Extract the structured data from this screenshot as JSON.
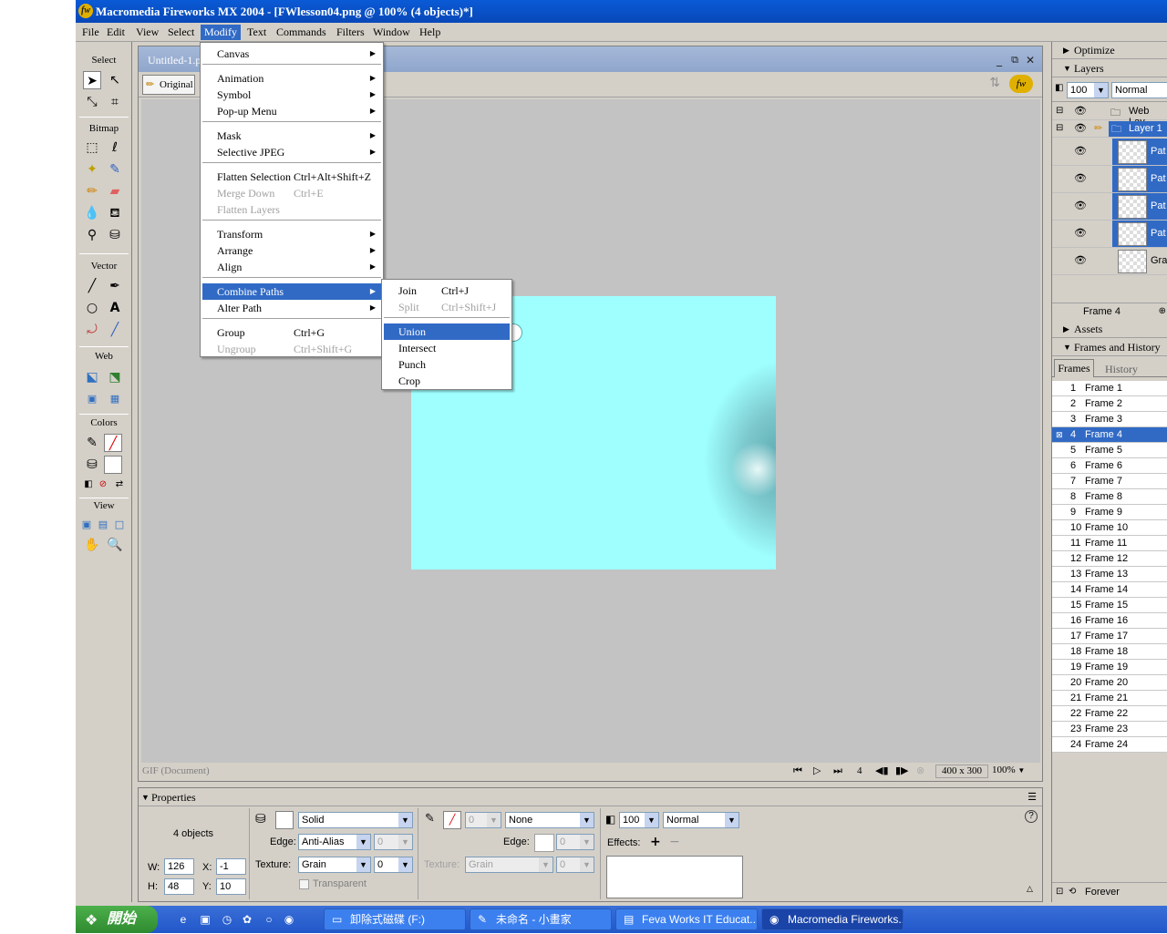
{
  "app": {
    "title": "Macromedia Fireworks MX 2004 - [FWlesson04.png @ 100% (4 objects)*]"
  },
  "menubar": [
    "File",
    "Edit",
    "View",
    "Select",
    "Modify",
    "Text",
    "Commands",
    "Filters",
    "Window",
    "Help"
  ],
  "toolbox": {
    "select": "Select",
    "bitmap": "Bitmap",
    "vector": "Vector",
    "web": "Web",
    "colors": "Colors",
    "view": "View"
  },
  "document": {
    "tab": "Untitled-1.p",
    "original": "Original",
    "status_left": "GIF (Document)",
    "frame_num": "4",
    "size": "400 x 300",
    "zoom": "100%"
  },
  "modify_menu": {
    "items": [
      {
        "label": "Canvas",
        "sub": true
      },
      {
        "label": "Animation",
        "sub": true
      },
      {
        "label": "Symbol",
        "sub": true
      },
      {
        "label": "Pop-up Menu",
        "sub": true
      },
      {
        "label": "Mask",
        "sub": true
      },
      {
        "label": "Selective JPEG",
        "sub": true
      },
      {
        "label": "Flatten Selection",
        "shortcut": "Ctrl+Alt+Shift+Z"
      },
      {
        "label": "Merge Down",
        "shortcut": "Ctrl+E",
        "disabled": true
      },
      {
        "label": "Flatten Layers",
        "disabled": true
      },
      {
        "label": "Transform",
        "sub": true
      },
      {
        "label": "Arrange",
        "sub": true
      },
      {
        "label": "Align",
        "sub": true
      },
      {
        "label": "Combine Paths",
        "sub": true,
        "highlighted": true
      },
      {
        "label": "Alter Path",
        "sub": true
      },
      {
        "label": "Group",
        "shortcut": "Ctrl+G"
      },
      {
        "label": "Ungroup",
        "shortcut": "Ctrl+Shift+G",
        "disabled": true
      }
    ]
  },
  "combine_menu": {
    "items": [
      {
        "label": "Join",
        "shortcut": "Ctrl+J"
      },
      {
        "label": "Split",
        "shortcut": "Ctrl+Shift+J",
        "disabled": true
      },
      {
        "label": "Union",
        "highlighted": true
      },
      {
        "label": "Intersect"
      },
      {
        "label": "Punch"
      },
      {
        "label": "Crop"
      }
    ]
  },
  "properties": {
    "title": "Properties",
    "objects": "4 objects",
    "fill_type": "Solid",
    "edge_label": "Edge:",
    "edge": "Anti-Alias",
    "edge_val": "0",
    "texture_label": "Texture:",
    "texture": "Grain",
    "texture_val": "0",
    "transparent": "Transparent",
    "stroke_size": "0",
    "stroke_type": "None",
    "stroke_edge_label": "Edge:",
    "stroke_edge_val": "0",
    "stroke_texture_label": "Texture:",
    "stroke_texture": "Grain",
    "stroke_texture_val": "0",
    "opacity": "100",
    "blend": "Normal",
    "effects": "Effects:",
    "w_label": "W:",
    "w": "126",
    "h_label": "H:",
    "h": "48",
    "x_label": "X:",
    "x": "-1",
    "y_label": "Y:",
    "y": "10"
  },
  "panels": {
    "optimize": "Optimize",
    "layers": "Layers",
    "layer_opacity": "100",
    "layer_blend": "Normal",
    "web_layer": "Web Lay",
    "layer1": "Layer 1",
    "objects": [
      "Pat",
      "Pat",
      "Pat",
      "Pat",
      "Gra"
    ],
    "frame_label": "Frame 4",
    "assets": "Assets",
    "frames_history": "Frames and History",
    "tab_frames": "Frames",
    "tab_history": "History",
    "frames": [
      {
        "n": "1",
        "name": "Frame 1"
      },
      {
        "n": "2",
        "name": "Frame 2"
      },
      {
        "n": "3",
        "name": "Frame 3"
      },
      {
        "n": "4",
        "name": "Frame 4",
        "selected": true
      },
      {
        "n": "5",
        "name": "Frame 5"
      },
      {
        "n": "6",
        "name": "Frame 6"
      },
      {
        "n": "7",
        "name": "Frame 7"
      },
      {
        "n": "8",
        "name": "Frame 8"
      },
      {
        "n": "9",
        "name": "Frame 9"
      },
      {
        "n": "10",
        "name": "Frame 10"
      },
      {
        "n": "11",
        "name": "Frame 11"
      },
      {
        "n": "12",
        "name": "Frame 12"
      },
      {
        "n": "13",
        "name": "Frame 13"
      },
      {
        "n": "14",
        "name": "Frame 14"
      },
      {
        "n": "15",
        "name": "Frame 15"
      },
      {
        "n": "16",
        "name": "Frame 16"
      },
      {
        "n": "17",
        "name": "Frame 17"
      },
      {
        "n": "18",
        "name": "Frame 18"
      },
      {
        "n": "19",
        "name": "Frame 19"
      },
      {
        "n": "20",
        "name": "Frame 20"
      },
      {
        "n": "21",
        "name": "Frame 21"
      },
      {
        "n": "22",
        "name": "Frame 22"
      },
      {
        "n": "23",
        "name": "Frame 23"
      },
      {
        "n": "24",
        "name": "Frame 24"
      }
    ],
    "loop": "Forever"
  },
  "taskbar": {
    "start": "開始",
    "tasks": [
      "卸除式磁碟 (F:)",
      "未命名 - 小畫家",
      "Feva Works IT Educat...",
      "Macromedia Fireworks..."
    ]
  },
  "colors": {
    "title_blue": "#0a5ad6",
    "highlight": "#316ac5",
    "canvas_fill": "#9fffff"
  }
}
